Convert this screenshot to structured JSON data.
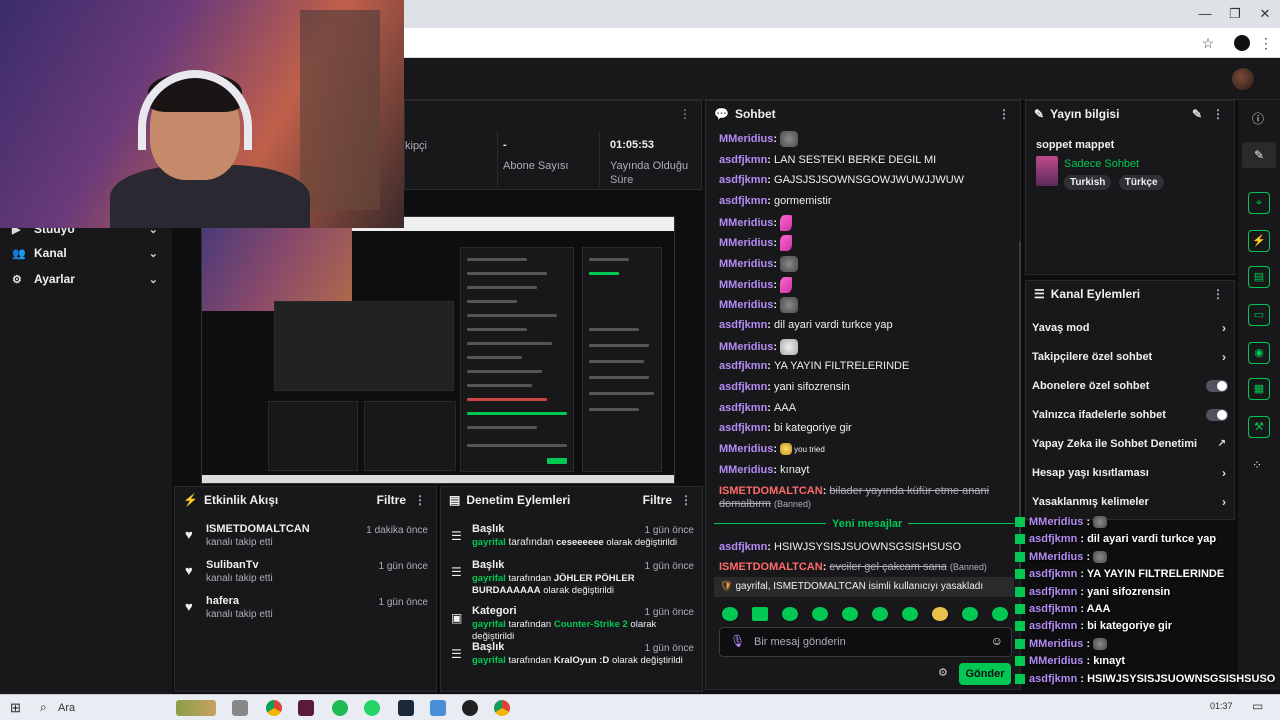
{
  "window": {
    "minimize": "—",
    "maximize": "❐",
    "close": "✕"
  },
  "browser": {
    "star_icon": "☆",
    "menu_icon": "⋮"
  },
  "sidebar": {
    "items": [
      {
        "label": "Stüdyo",
        "icon": "video-icon"
      },
      {
        "label": "Kanal",
        "icon": "users-icon"
      },
      {
        "label": "Ayarlar",
        "icon": "gear-icon"
      }
    ]
  },
  "stats": {
    "items": [
      {
        "value": "",
        "label": "kipçi"
      },
      {
        "value": "-",
        "label": "Abone Sayısı"
      },
      {
        "value": "01:05:53",
        "label": "Yayında Olduğu Süre"
      }
    ]
  },
  "activity": {
    "title": "Etkinlik Akışı",
    "filter": "Filtre",
    "items": [
      {
        "name": "ISMETDOMALTCAN",
        "sub": "kanalı takip etti",
        "time": "1 dakika önce"
      },
      {
        "name": "SulibanTv",
        "sub": "kanalı takip etti",
        "time": "1 gün önce"
      },
      {
        "name": "hafera",
        "sub": "kanalı takip etti",
        "time": "1 gün önce"
      }
    ]
  },
  "moderation": {
    "title": "Denetim Eylemleri",
    "filter": "Filtre",
    "items": [
      {
        "title": "Başlık",
        "user": "gayrifal",
        "mid": "tarafından",
        "value": "ceseeeeee",
        "end": "olarak değiştirildi",
        "time": "1 gün önce"
      },
      {
        "title": "Başlık",
        "user": "gayrifal",
        "mid": "tarafından",
        "value": "JÖHLER PÖHLER BURDAAAAAA",
        "end": "olarak değiştirildi",
        "time": "1 gün önce"
      },
      {
        "title": "Kategori",
        "user": "gayrifal",
        "mid": "tarafından",
        "value": "Counter-Strike 2",
        "end": "olarak değiştirildi",
        "time": "1 gün önce"
      },
      {
        "title": "Başlık",
        "user": "gayrifal",
        "mid": "tarafından",
        "value": "KralOyun :D",
        "end": "olarak değiştirildi",
        "time": "1 gün önce"
      }
    ]
  },
  "chat": {
    "title": "Sohbet",
    "messages": [
      {
        "user": "MMeridius",
        "text": "",
        "emote": "cat"
      },
      {
        "user": "asdfjkmn",
        "text": "LAN SESTEKI BERKE DEGIL MI"
      },
      {
        "user": "asdfjkmn",
        "text": "GAJSJSJSOWNSGOWJWUWJJWUW"
      },
      {
        "user": "asdfjkmn",
        "text": "gormemistir"
      },
      {
        "user": "MMeridius",
        "text": "",
        "emote": "pink"
      },
      {
        "user": "MMeridius",
        "text": "",
        "emote": "pink"
      },
      {
        "user": "MMeridius",
        "text": "",
        "emote": "cat"
      },
      {
        "user": "MMeridius",
        "text": "",
        "emote": "pink"
      },
      {
        "user": "MMeridius",
        "text": "",
        "emote": "cat"
      },
      {
        "user": "asdfjkmn",
        "text": "dil ayari vardi turkce yap"
      },
      {
        "user": "MMeridius",
        "text": "",
        "emote": "white"
      },
      {
        "user": "asdfjkmn",
        "text": "YA YAYIN FILTRELERINDE"
      },
      {
        "user": "asdfjkmn",
        "text": "yani sifozrensin"
      },
      {
        "user": "asdfjkmn",
        "text": "AAA"
      },
      {
        "user": "asdfjkmn",
        "text": "bi kategoriye gir"
      },
      {
        "user": "MMeridius",
        "text": "you tried",
        "emote": "star"
      },
      {
        "user": "MMeridius",
        "text": "kınayt"
      }
    ],
    "banned1_user": "ISMETDOMALTCAN",
    "banned1_text": "bilader yayında küfür etme anani domalbırm",
    "banned_tag": "(Banned)",
    "new_messages": "Yeni mesajlar",
    "after": [
      {
        "user": "asdfjkmn",
        "text": "HSIWJSYSISJSUOWNSGSISHSUSO"
      }
    ],
    "banned2_user": "ISMETDOMALTCAN",
    "banned2_text": "evciler gel çakcam sana",
    "system_notice": "gayrifal, ISMETDOMALTCAN isimli kullanıcıyı yasakladı",
    "input_placeholder": "Bir mesaj gönderin",
    "send_label": "Gönder"
  },
  "streaminfo": {
    "title": "Yayın bilgisi",
    "stream_title": "soppet mappet",
    "category": "Sadece Sohbet",
    "tags": [
      "Turkish",
      "Türkçe"
    ]
  },
  "actions": {
    "title": "Kanal Eylemleri",
    "items": [
      {
        "label": "Yavaş mod",
        "control": "chevron"
      },
      {
        "label": "Takipçilere özel sohbet",
        "control": "chevron"
      },
      {
        "label": "Abonelere özel sohbet",
        "control": "toggle"
      },
      {
        "label": "Yalnızca ifadelerle sohbet",
        "control": "toggle"
      },
      {
        "label": "Yapay Zeka ile Sohbet Denetimi",
        "control": "external"
      },
      {
        "label": "Hesap yaşı kısıtlaması",
        "control": "chevron"
      },
      {
        "label": "Yasaklanmış kelimeler",
        "control": "chevron"
      }
    ]
  },
  "overlay_chat": [
    {
      "user": "MMeridius",
      "text": ""
    },
    {
      "user": "asdfjkmn",
      "text": "dil ayari vardi turkce yap"
    },
    {
      "user": "MMeridius",
      "text": ""
    },
    {
      "user": "asdfjkmn",
      "text": "YA YAYIN FILTRELERINDE"
    },
    {
      "user": "asdfjkmn",
      "text": "yani sifozrensin"
    },
    {
      "user": "asdfjkmn",
      "text": "AAA"
    },
    {
      "user": "asdfjkmn",
      "text": "bi kategoriye gir"
    },
    {
      "user": "MMeridius",
      "text": ""
    },
    {
      "user": "MMeridius",
      "text": "kınayt"
    },
    {
      "user": "asdfjkmn",
      "text": "HSIWJSYSISJSUOWNSGSISHSUSO"
    }
  ],
  "taskbar": {
    "search_placeholder": "Ara",
    "time": "01:37"
  },
  "colors": {
    "accent": "#00c853",
    "background": "#0e0e10",
    "panel": "#18181b",
    "username": "#b48cf5",
    "banned_user": "#ff6a6a"
  }
}
